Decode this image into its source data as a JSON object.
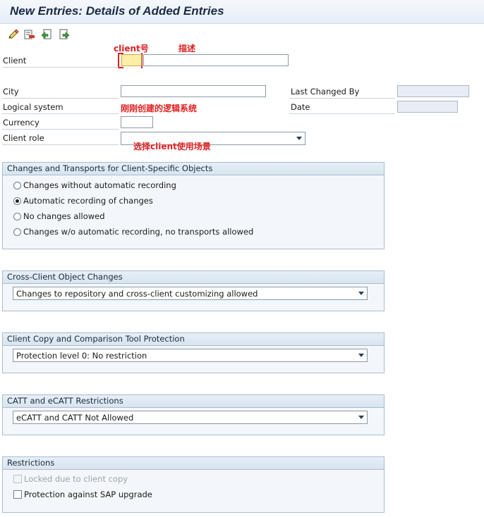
{
  "title": "New Entries: Details of Added Entries",
  "toolbar": {
    "icons": [
      "edit-pen-icon",
      "delete-row-icon",
      "previous-entry-icon",
      "next-entry-icon"
    ]
  },
  "annotations": {
    "client_no": "client号",
    "description": "描述",
    "logical_system": "刚刚创建的逻辑系统",
    "client_role": "选择client使用场景",
    "color": "#e02020"
  },
  "form": {
    "client_label": "Client",
    "client_value": "",
    "client_desc_value": "",
    "city_label": "City",
    "city_value": "",
    "logical_system_label": "Logical system",
    "currency_label": "Currency",
    "currency_value": "",
    "client_role_label": "Client role",
    "client_role_value": "",
    "last_changed_by_label": "Last Changed By",
    "last_changed_by_value": "",
    "date_label": "Date",
    "date_value": ""
  },
  "groups": {
    "transports": {
      "title": "Changes and Transports for Client-Specific Objects",
      "options": [
        {
          "label": "Changes without automatic recording",
          "selected": false
        },
        {
          "label": "Automatic recording of changes",
          "selected": true
        },
        {
          "label": "No changes allowed",
          "selected": false
        },
        {
          "label": "Changes w/o automatic recording, no transports allowed",
          "selected": false
        }
      ]
    },
    "cross_client": {
      "title": "Cross-Client Object Changes",
      "value": "Changes to repository and cross-client customizing allowed"
    },
    "copy_protection": {
      "title": "Client Copy and Comparison Tool Protection",
      "value": "Protection level 0: No restriction"
    },
    "catt": {
      "title": "CATT and eCATT Restrictions",
      "value": "eCATT and CATT Not Allowed"
    },
    "restrictions": {
      "title": "Restrictions",
      "locked_label": "Locked due to client copy",
      "locked_checked": false,
      "locked_enabled": false,
      "protection_label": "Protection against SAP upgrade",
      "protection_checked": false
    }
  }
}
